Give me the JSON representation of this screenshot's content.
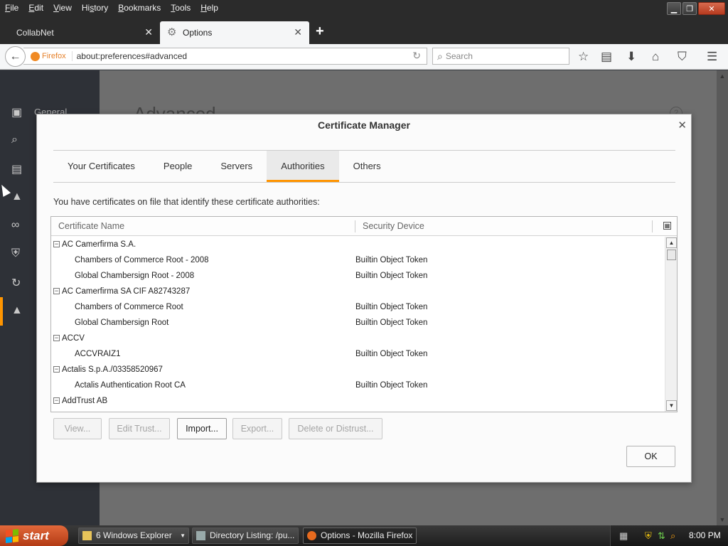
{
  "menu": [
    {
      "label": "File",
      "u": "F"
    },
    {
      "label": "Edit",
      "u": "E"
    },
    {
      "label": "View",
      "u": "V"
    },
    {
      "label": "History",
      "u": "s"
    },
    {
      "label": "Bookmarks",
      "u": "B"
    },
    {
      "label": "Tools",
      "u": "T"
    },
    {
      "label": "Help",
      "u": "H"
    }
  ],
  "tabs": {
    "inactive": "CollabNet",
    "active": "Options"
  },
  "navbar": {
    "identity": "Firefox",
    "url": "about:preferences#advanced",
    "search_placeholder": "Search"
  },
  "prefs": {
    "category_label": "General",
    "title": "Advanced"
  },
  "dialog": {
    "title": "Certificate Manager",
    "tabs": [
      "Your Certificates",
      "People",
      "Servers",
      "Authorities",
      "Others"
    ],
    "selected_tab": "Authorities",
    "description": "You have certificates on file that identify these certificate authorities:",
    "columns": [
      "Certificate Name",
      "Security Device"
    ],
    "rows": [
      {
        "name": "AC Camerfirma S.A.",
        "device": "",
        "group": true
      },
      {
        "name": "Chambers of Commerce Root - 2008",
        "device": "Builtin Object Token",
        "group": false
      },
      {
        "name": "Global Chambersign Root - 2008",
        "device": "Builtin Object Token",
        "group": false
      },
      {
        "name": "AC Camerfirma SA CIF A82743287",
        "device": "",
        "group": true
      },
      {
        "name": "Chambers of Commerce Root",
        "device": "Builtin Object Token",
        "group": false
      },
      {
        "name": "Global Chambersign Root",
        "device": "Builtin Object Token",
        "group": false
      },
      {
        "name": "ACCV",
        "device": "",
        "group": true
      },
      {
        "name": "ACCVRAIZ1",
        "device": "Builtin Object Token",
        "group": false
      },
      {
        "name": "Actalis S.p.A./03358520967",
        "device": "",
        "group": true
      },
      {
        "name": "Actalis Authentication Root CA",
        "device": "Builtin Object Token",
        "group": false
      },
      {
        "name": "AddTrust AB",
        "device": "",
        "group": true
      }
    ],
    "buttons": {
      "view": "View...",
      "edit_trust": "Edit Trust...",
      "import": "Import...",
      "export": "Export...",
      "delete": "Delete or Distrust..."
    },
    "ok": "OK"
  },
  "taskbar": {
    "start": "start",
    "tasks": [
      "6 Windows Explorer",
      "Directory Listing: /pu...",
      "Options - Mozilla Firefox"
    ],
    "clock": "8:00 PM"
  },
  "colors": {
    "accent": "#ff9400",
    "sidebar": "#2e3137",
    "start": "#c94f26"
  }
}
